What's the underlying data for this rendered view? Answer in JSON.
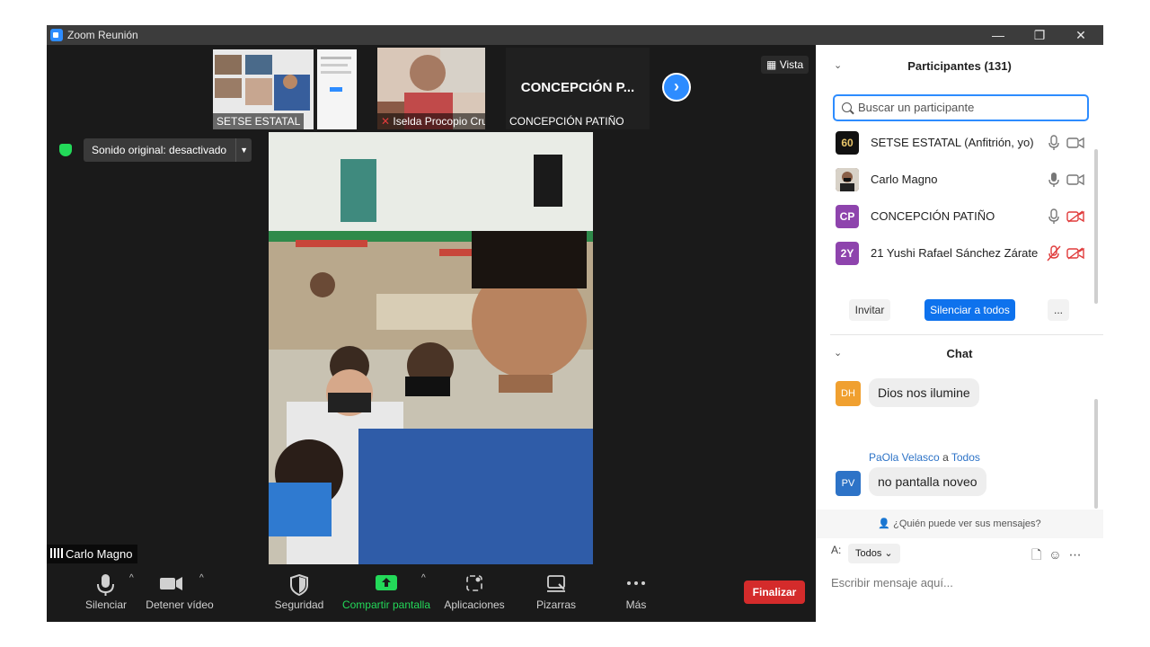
{
  "window": {
    "title": "Zoom Reunión",
    "minimize": "—",
    "restore": "❐",
    "close": "✕"
  },
  "colors": {
    "accent": "#2d8cff",
    "end": "#d42b2b",
    "share": "#23d959",
    "muted": "#e03b3b"
  },
  "thumbnails": [
    {
      "name": "SETSE ESTATAL"
    },
    {
      "name": "Iselda Procopio Cruz"
    },
    {
      "name": "CONCEPCIÓN PATIÑO",
      "big_label": "CONCEPCIÓN  P..."
    }
  ],
  "view_label": "Vista",
  "sound_button": "Sonido original: desactivado",
  "speaker_name": "Carlo Magno",
  "toolbar": {
    "mute": "Silenciar",
    "stop_video": "Detener vídeo",
    "security": "Seguridad",
    "share": "Compartir pantalla",
    "apps": "Aplicaciones",
    "whiteboard": "Pizarras",
    "more": "Más",
    "end": "Finalizar"
  },
  "participants": {
    "header": "Participantes (131)",
    "search_placeholder": "Buscar un participante",
    "list": [
      {
        "avatar": "60",
        "name": "SETSE ESTATAL (Anfitrión, yo)",
        "avatar_color": "#111111",
        "mic_muted": false,
        "cam_off": false
      },
      {
        "avatar": "",
        "name": "Carlo Magno",
        "avatar_color": "#6b4e3a",
        "mic_muted": false,
        "cam_off": false
      },
      {
        "avatar": "CP",
        "name": "CONCEPCIÓN PATIÑO",
        "avatar_color": "#8e44ad",
        "mic_muted": false,
        "cam_off": true
      },
      {
        "avatar": "2Y",
        "name": "21 Yushi Rafael Sánchez Zárate",
        "avatar_color": "#8e44ad",
        "mic_muted": true,
        "cam_off": true
      }
    ],
    "invite": "Invitar",
    "mute_all": "Silenciar a todos",
    "more": "..."
  },
  "chat": {
    "header": "Chat",
    "messages": [
      {
        "initials": "DH",
        "avatar_color": "#f0a030",
        "text": "Dios nos ilumine"
      },
      {
        "initials": "PV",
        "avatar_color": "#2d73c7",
        "sender": "PaOla Velasco",
        "to_word": "a",
        "recipient": "Todos",
        "text": "no pantalla noveo"
      }
    ],
    "who_can_see": "¿Quién puede ver sus mensajes?",
    "to_label": "A:",
    "to_value": "Todos",
    "input_placeholder": "Escribir mensaje aquí..."
  }
}
